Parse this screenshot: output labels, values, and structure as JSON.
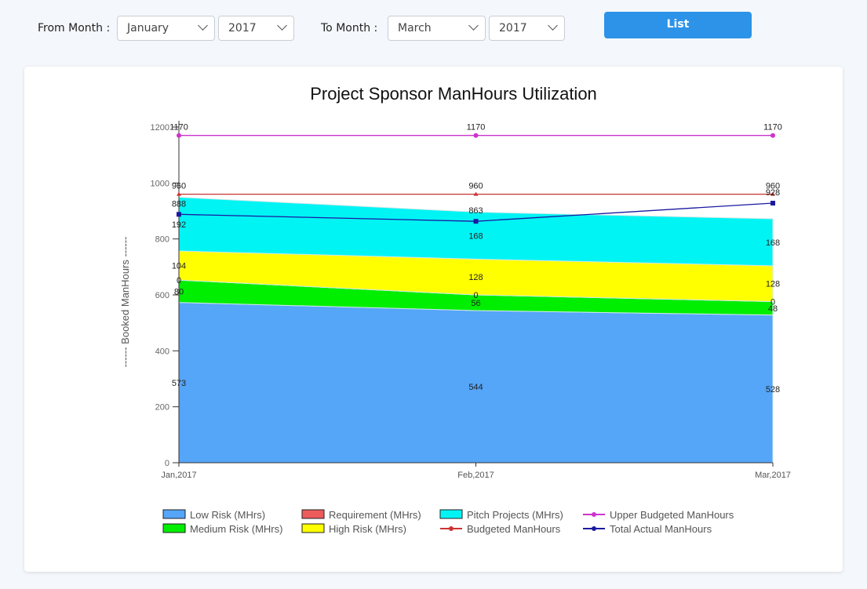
{
  "filters": {
    "from_label": "From Month :",
    "from_month": "January",
    "from_year": "2017",
    "to_label": "To Month :",
    "to_month": "March",
    "to_year": "2017",
    "list_button": "List"
  },
  "chart_data": {
    "type": "area",
    "title": "Project Sponsor ManHours Utilization",
    "xlabel": "",
    "ylabel": "------ Booked ManHours ------",
    "categories": [
      "Jan,2017",
      "Feb,2017",
      "Mar,2017"
    ],
    "ylim": [
      0,
      1200
    ],
    "yticks": [
      0,
      200,
      400,
      600,
      800,
      1000,
      1200
    ],
    "stacked_series": [
      {
        "name": "Low Risk (MHrs)",
        "color": "#55a5f8",
        "values": [
          573,
          544,
          528
        ]
      },
      {
        "name": "Medium Risk (MHrs)",
        "color": "#00ee00",
        "values": [
          80,
          56,
          48
        ]
      },
      {
        "name": "Requirement (MHrs)",
        "color": "#ee5b5b",
        "values": [
          0,
          0,
          0
        ]
      },
      {
        "name": "High Risk (MHrs)",
        "color": "#ffff00",
        "values": [
          104,
          128,
          128
        ]
      },
      {
        "name": "Pitch Projects (MHrs)",
        "color": "#00f4f4",
        "values": [
          192,
          168,
          168
        ]
      }
    ],
    "line_series": [
      {
        "name": "Upper Budgeted ManHours",
        "color": "#cc33cc",
        "marker": "circle",
        "values": [
          1170,
          1170,
          1170
        ]
      },
      {
        "name": "Budgeted ManHours",
        "color": "#cc3333",
        "marker": "triangle",
        "values": [
          960,
          960,
          960
        ]
      },
      {
        "name": "Total Actual ManHours",
        "color": "#1a1aa0",
        "marker": "square",
        "values": [
          888,
          863,
          928
        ]
      }
    ],
    "legend": {
      "placement": "bottom",
      "rows": [
        [
          "Low Risk (MHrs)",
          "Requirement (MHrs)",
          "Pitch Projects (MHrs)",
          "Upper Budgeted ManHours"
        ],
        [
          "Medium Risk (MHrs)",
          "High Risk (MHrs)",
          "Budgeted ManHours",
          "Total Actual ManHours"
        ]
      ]
    },
    "grid": false
  }
}
